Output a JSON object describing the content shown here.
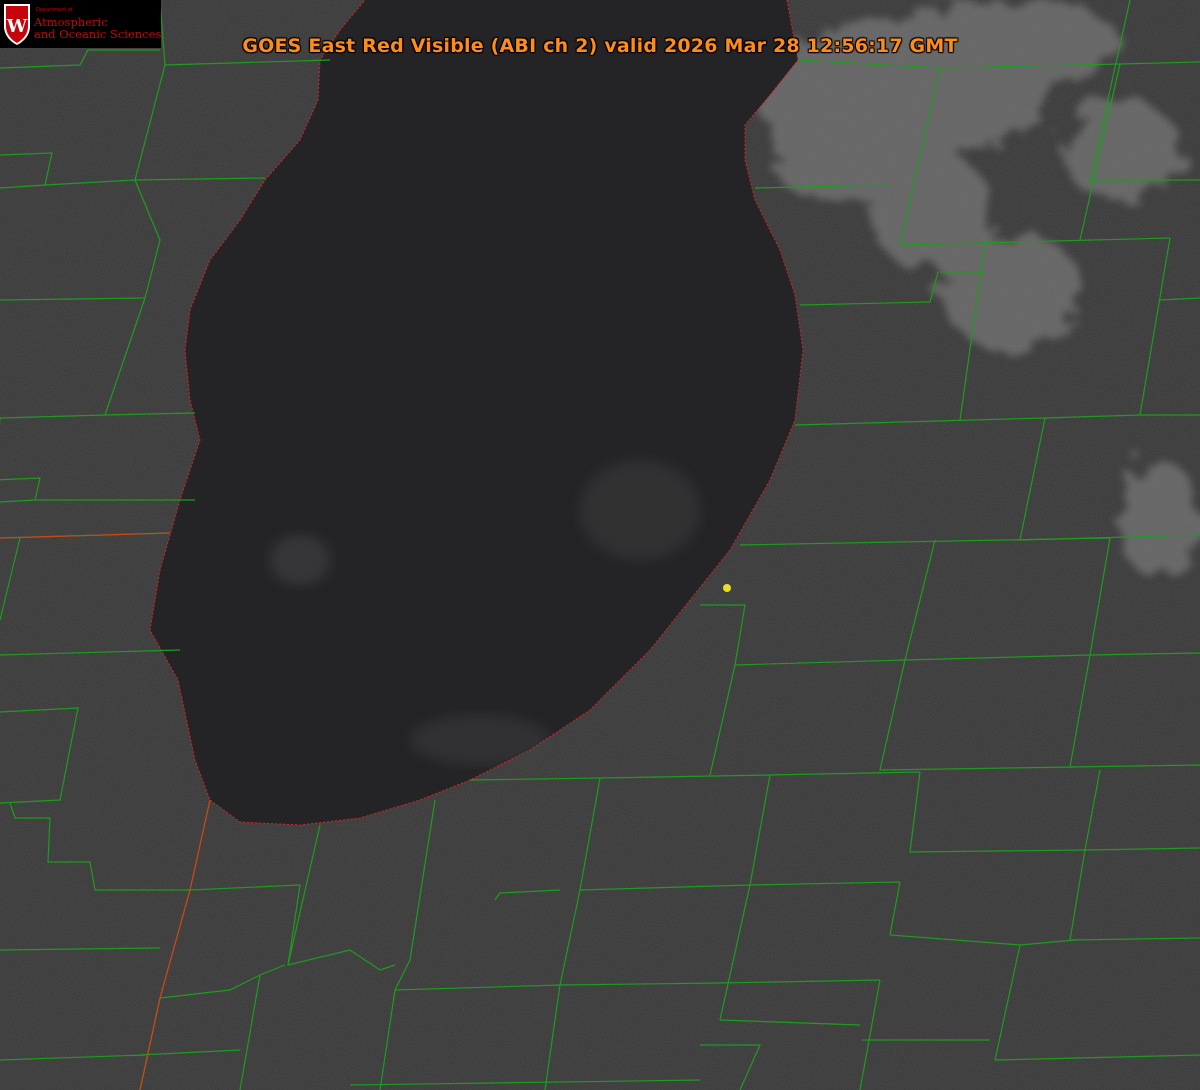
{
  "map": {
    "title": "GOES East Red Visible (ABI ch 2) valid 2026 Mar 28 12:56:17 GMT",
    "satellite": "GOES East",
    "band": "Red Visible (ABI ch 2)",
    "valid_time": "2026 Mar 28 12:56:17 GMT",
    "features": [
      "lake",
      "county-boundaries",
      "state-boundary",
      "shoreline",
      "location-marker"
    ]
  },
  "logo": {
    "small_text": "Department of",
    "line1": "Atmospheric",
    "line2": "and Oceanic Sciences",
    "shield_letter": "W"
  },
  "colors": {
    "title": "#ff8c1a",
    "logo_text": "#c5050c",
    "shield": "#c5050c",
    "county_lines": "#1e9c1e",
    "state_line": "#c84818",
    "shoreline": "#e02020",
    "marker": "#e8e020",
    "land": "#353535",
    "lake": "#242427",
    "cloud": "#8a8a8a"
  }
}
